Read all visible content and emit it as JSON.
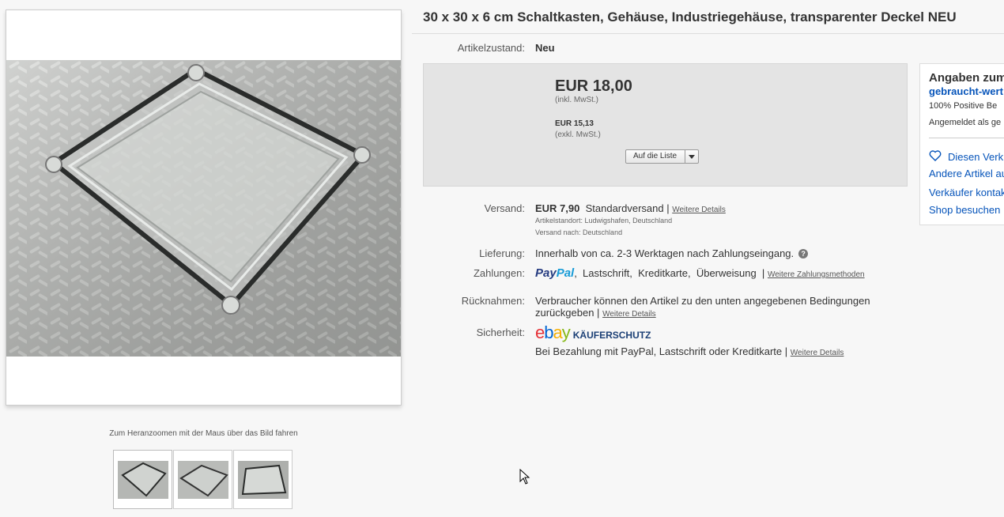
{
  "gallery": {
    "zoom_hint": "Zum Heranzoomen mit der Maus über das Bild fahren"
  },
  "title": "30 x 30 x 6 cm Schaltkasten, Gehäuse, Industriegehäuse, transparenter Deckel NEU",
  "condition": {
    "label": "Artikelzustand:",
    "value": "Neu"
  },
  "price": {
    "gross": "EUR 18,00",
    "gross_note": "(inkl. MwSt.)",
    "net": "EUR 15,13",
    "net_note": "(exkl. MwSt.)",
    "watch_button": "Auf die Liste"
  },
  "shipping": {
    "label": "Versand:",
    "cost": "EUR 7,90",
    "method": "Standardversand |",
    "details_link": "Weitere Details",
    "location": "Artikelstandort:  Ludwigshafen, Deutschland",
    "ships_to": "Versand nach:  Deutschland"
  },
  "delivery": {
    "label": "Lieferung:",
    "value": "Innerhalb von ca. 2-3 Werktagen nach Zahlungseingang."
  },
  "payment": {
    "label": "Zahlungen:",
    "paypal_pay": "Pay",
    "paypal_pal": "Pal",
    "methods": ",  Lastschrift,  Kreditkarte,  Überweisung  |",
    "more_link": "Weitere Zahlungsmethoden"
  },
  "returns": {
    "label": "Rücknahmen:",
    "line1": "Verbraucher können den Artikel zu den unten angegebenen Bedingungen",
    "line2": "zurückgeben |",
    "details_link": "Weitere Details"
  },
  "security": {
    "label": "Sicherheit:",
    "ebay_letters": [
      "e",
      "b",
      "a",
      "y"
    ],
    "protection": "KÄUFERSCHUTZ",
    "text": "Bei Bezahlung mit PayPal, Lastschrift oder Kreditkarte |",
    "details_link": "Weitere Details"
  },
  "seller": {
    "heading": "Angaben zum",
    "name": "gebraucht-wert",
    "positive": "100% Positive Be",
    "registered": "Angemeldet als ge",
    "save_seller": "Diesen Verk",
    "other_items": "Andere Artikel au",
    "contact": "Verkäufer kontakt",
    "shop": "Shop besuchen"
  },
  "colors": {
    "link_blue": "#0654ba",
    "ebay_red": "#e53238",
    "ebay_blue": "#0064d2",
    "ebay_yellow": "#f5af02",
    "ebay_green": "#86b817",
    "paypal_dark": "#253b80",
    "paypal_light": "#179bd7"
  }
}
